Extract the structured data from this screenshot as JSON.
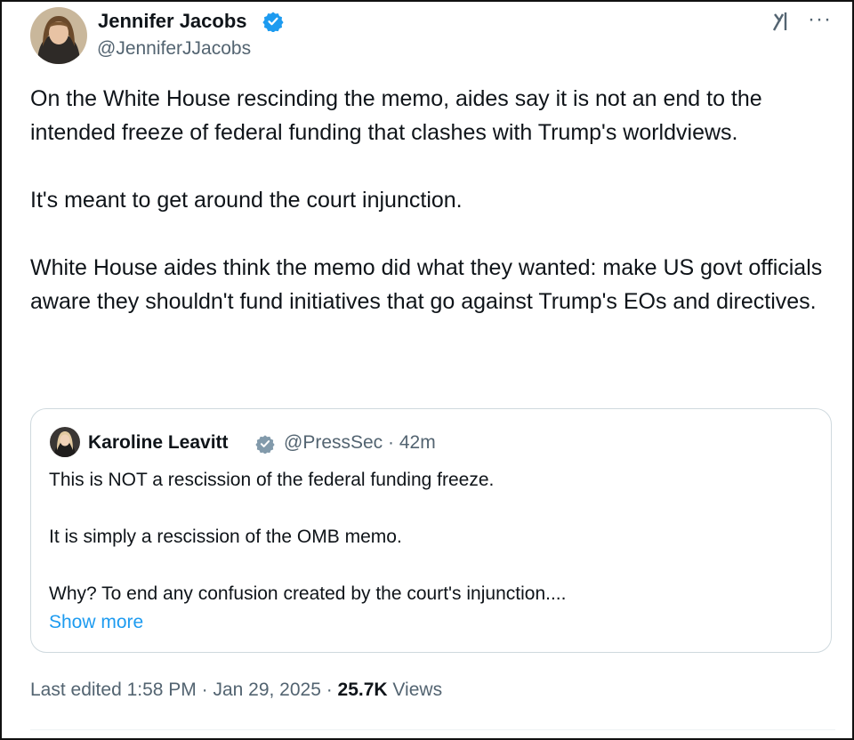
{
  "tweet": {
    "author_name": "Jennifer Jacobs",
    "author_handle": "@JenniferJJacobs",
    "paragraphs": [
      "On the White House rescinding the memo, aides say it is not an end to the intended freeze of federal funding that clashes with Trump's worldviews.",
      "It's meant to get around the court injunction.",
      "White House aides think the memo did what they wanted: make US govt officials aware they shouldn't fund initiatives that go against Trump's EOs and directives."
    ],
    "more_icon": "···",
    "icons": {
      "verified": "blue-verified-badge",
      "grok": "grok-icon",
      "more": "more-options-icon"
    },
    "colors": {
      "verified_blue": "#1d9bf0",
      "verified_gray": "#829aab",
      "link": "#1d9bf0",
      "secondary_text": "#536471",
      "quote_border": "#cfd9de"
    }
  },
  "quote": {
    "author_name": "Karoline Leavitt",
    "author_handle_time": "@PressSec · 42m",
    "paragraphs": [
      "This is NOT a rescission of the federal funding freeze.",
      "It is simply a rescission of the OMB memo.",
      "Why? To end any confusion created by the court's injunction...."
    ],
    "show_more": "Show more"
  },
  "meta": {
    "edited": "Last edited 1:58 PM · Jan 29, 2025 · ",
    "views_count": "25.7K",
    "views_label": " Views"
  }
}
